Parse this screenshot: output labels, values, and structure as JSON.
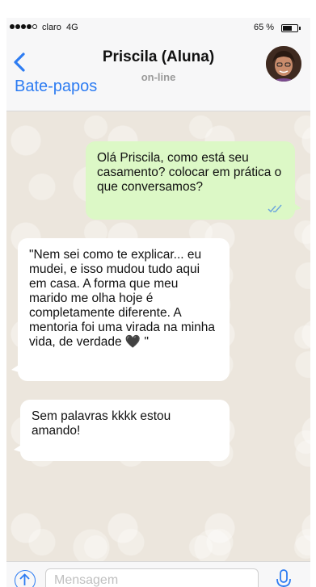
{
  "status_bar": {
    "carrier": "claro",
    "network": "4G",
    "battery": "65 %",
    "battery_level": 0.65
  },
  "header": {
    "back_label": "Bate-papos",
    "contact_name": "Priscila (Aluna)",
    "contact_status": "on-line"
  },
  "messages": [
    {
      "direction": "outgoing",
      "text": "Olá Priscila, como está seu casamento? colocar em prática o que conversamos?",
      "status_icon": "double-check-icon"
    },
    {
      "direction": "incoming",
      "text": "\"Nem sei como te explicar... eu mudei, e isso mudou tudo aqui em casa. A forma que meu marido me olha hoje é completamente diferente. A mentoria foi uma virada na minha vida, de verdade 🖤 \""
    },
    {
      "direction": "incoming",
      "text": "Sem palavras kkkk estou amando!"
    }
  ],
  "input_bar": {
    "placeholder": "Mensagem",
    "upload_icon": "upload-arrow-icon",
    "mic_icon": "microphone-icon"
  },
  "colors": {
    "accent": "#2d7cf2",
    "outgoing_bubble": "#dcf8c6",
    "incoming_bubble": "#ffffff",
    "chat_background": "#ece6dd"
  }
}
